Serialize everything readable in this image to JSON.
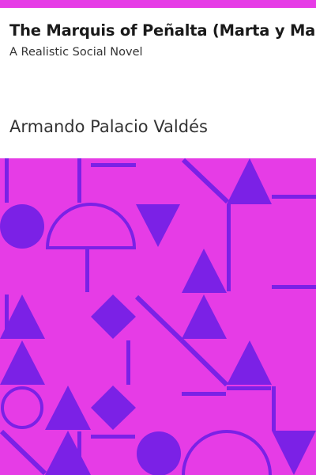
{
  "book": {
    "title": "The Marquis of Peñalta (Marta y María)",
    "subtitle": "A Realistic Social Novel",
    "author": "Armando Palacio Valdés"
  },
  "colors": {
    "background": "#e63ce6",
    "shape": "#7b21e6",
    "text": "#1a1a1a"
  },
  "art": {
    "pattern": "geometric-cover-pattern"
  }
}
